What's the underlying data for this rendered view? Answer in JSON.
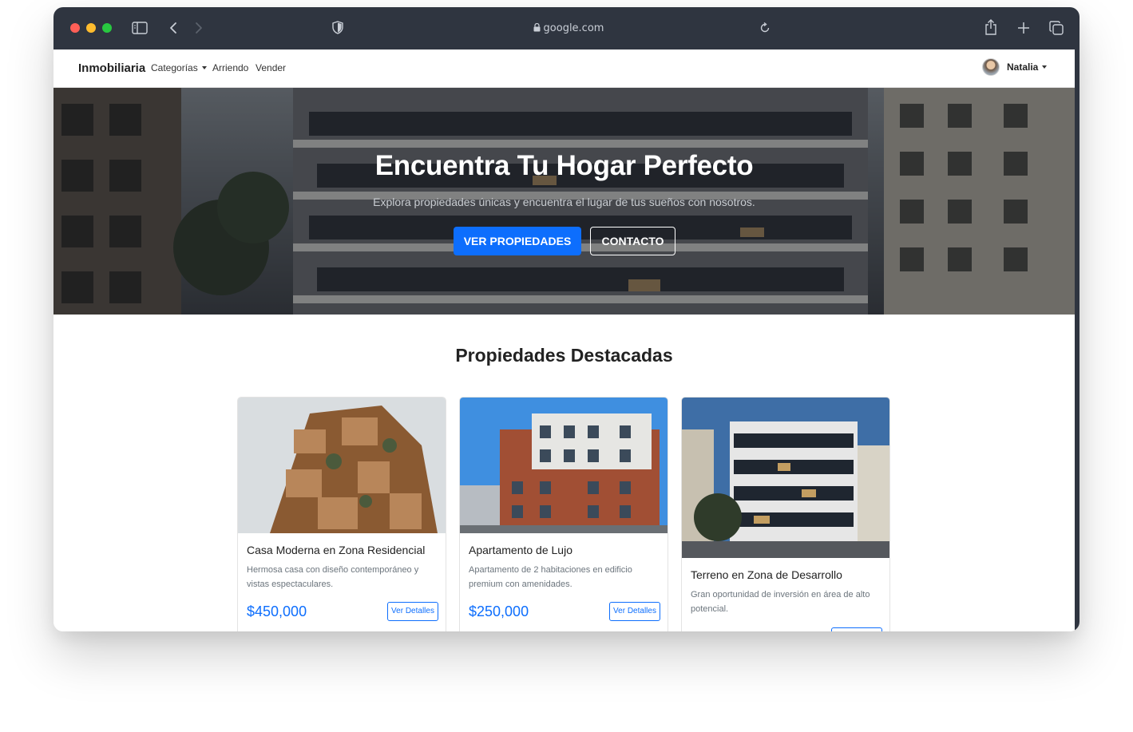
{
  "browser": {
    "url": "google.com"
  },
  "navbar": {
    "brand": "Inmobiliaria",
    "links": [
      {
        "label": "Categorías",
        "has_dropdown": true
      },
      {
        "label": "Arriendo"
      },
      {
        "label": "Vender"
      }
    ],
    "user": {
      "name": "Natalia",
      "has_dropdown": true
    }
  },
  "hero": {
    "title": "Encuentra Tu Hogar Perfecto",
    "subtitle": "Explora propiedades únicas y encuentra el lugar de tus sueños con nosotros.",
    "primary_button": "VER PROPIEDADES",
    "secondary_button": "CONTACTO"
  },
  "featured": {
    "title": "Propiedades Destacadas",
    "cards": [
      {
        "title": "Casa Moderna en Zona Residencial",
        "description": "Hermosa casa con diseño contemporáneo y vistas espectaculares.",
        "price": "$450,000",
        "button": "Ver Detalles"
      },
      {
        "title": "Apartamento de Lujo",
        "description": "Apartamento de 2 habitaciones en edificio premium con amenidades.",
        "price": "$250,000",
        "button": "Ver Detalles"
      },
      {
        "title": "Terreno en Zona de Desarrollo",
        "description": "Gran oportunidad de inversión en área de alto potencial.",
        "price": "",
        "button": ""
      }
    ]
  },
  "colors": {
    "primary": "#0d6efd",
    "chrome": "#2f3540",
    "text_muted": "#6c757d"
  }
}
